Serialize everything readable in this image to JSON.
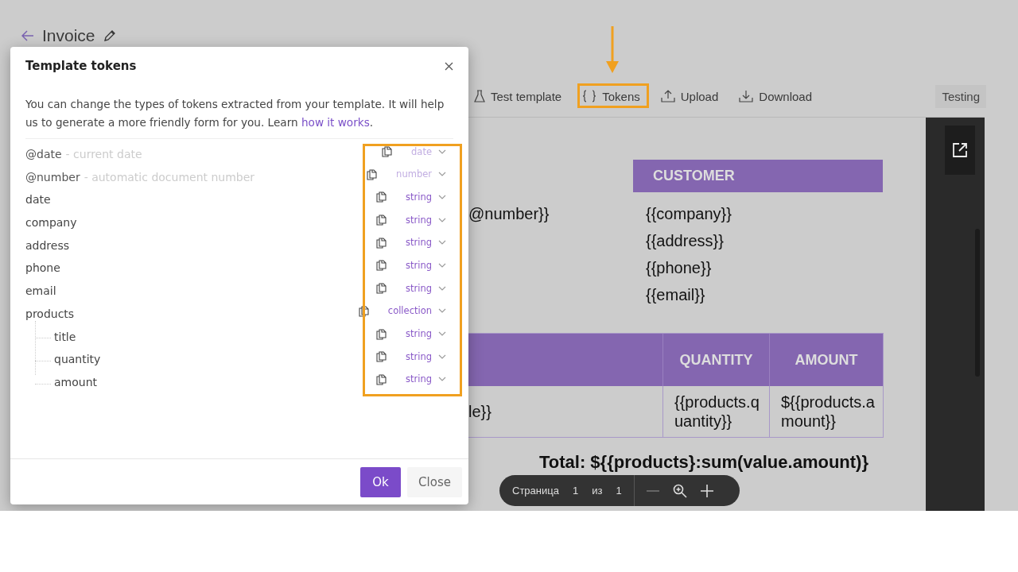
{
  "page": {
    "title": "Invoice"
  },
  "toolbar": [
    {
      "label": "Test template",
      "kind": "test"
    },
    {
      "label": "Tokens",
      "kind": "tokens"
    },
    {
      "label": "Upload",
      "kind": "upload"
    },
    {
      "label": "Download",
      "kind": "download"
    }
  ],
  "mode_badge": "Testing",
  "document": {
    "customer_heading": "CUSTOMER",
    "number_cell": "@number}}",
    "customer_lines": [
      "{{company}}",
      "{{address}}",
      "{{phone}}",
      "{{email}}"
    ],
    "table_columns": [
      "QUANTITY",
      "AMOUNT"
    ],
    "table_row": [
      "le}}",
      "{{products.quantity}}",
      "${{products.amount}}"
    ],
    "total": "Total: ${{products}:sum(value.amount)}"
  },
  "pager": {
    "label": "Страница",
    "page": "1",
    "of": "из",
    "total": "1"
  },
  "modal": {
    "title": "Template tokens",
    "description": "You can change the types of tokens extracted from your template. It will help us to generate a more friendly form for you. Learn ",
    "link": "how it works",
    "description_end": ".",
    "tokens": [
      {
        "name": "@date",
        "note": "- current date",
        "type": "date",
        "disabled": true
      },
      {
        "name": "@number",
        "note": "- automatic document number",
        "type": "number",
        "disabled": true
      },
      {
        "name": "date",
        "type": "string",
        "disabled": false
      },
      {
        "name": "company",
        "type": "string",
        "disabled": false
      },
      {
        "name": "address",
        "type": "string",
        "disabled": false
      },
      {
        "name": "phone",
        "type": "string",
        "disabled": false
      },
      {
        "name": "email",
        "type": "string",
        "disabled": false
      },
      {
        "name": "products",
        "type": "collection",
        "disabled": false,
        "children": [
          {
            "name": "title",
            "type": "string",
            "disabled": false
          },
          {
            "name": "quantity",
            "type": "string",
            "disabled": false
          },
          {
            "name": "amount",
            "type": "string",
            "disabled": false
          }
        ]
      }
    ],
    "buttons": [
      {
        "label": "Ok",
        "kind": "primary"
      },
      {
        "label": "Close",
        "kind": "secondary"
      }
    ]
  }
}
